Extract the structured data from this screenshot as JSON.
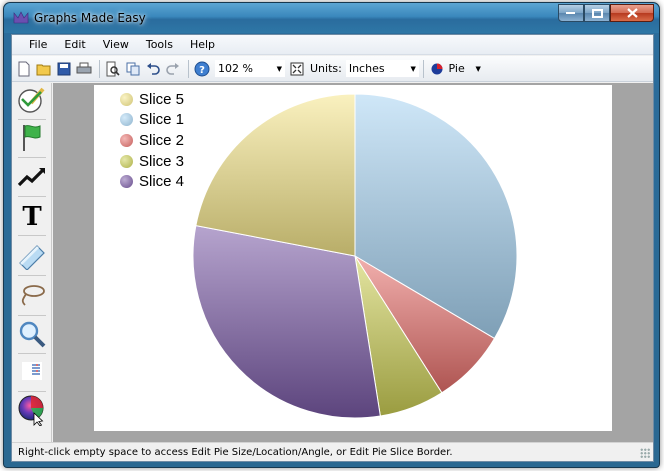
{
  "window": {
    "title": "Graphs Made Easy"
  },
  "menu": [
    "File",
    "Edit",
    "View",
    "Tools",
    "Help"
  ],
  "toolbar": {
    "zoom_value": "102 %",
    "units_label": "Units:",
    "units_value": "Inches",
    "chart_type_value": "Pie"
  },
  "palette": {
    "tools": [
      "select-tool",
      "flag-tool",
      "trend-line-tool",
      "text-tool",
      "eraser-tool",
      "lasso-tool",
      "zoom-tool",
      "table-tool",
      "pie-chart-tool"
    ]
  },
  "chart_data": {
    "type": "pie",
    "slices": [
      {
        "name": "Slice 1",
        "value": 33.5,
        "color": "#a8d4f2"
      },
      {
        "name": "Slice 2",
        "value": 7.5,
        "color": "#e8706c"
      },
      {
        "name": "Slice 3",
        "value": 6.5,
        "color": "#cdd055"
      },
      {
        "name": "Slice 4",
        "value": 30.5,
        "color": "#7a5aa6"
      },
      {
        "name": "Slice 5",
        "value": 22.0,
        "color": "#f5e68a"
      }
    ],
    "legend_order": [
      "Slice 5",
      "Slice 1",
      "Slice 2",
      "Slice 3",
      "Slice 4"
    ],
    "start_angle_deg": -90
  },
  "status": {
    "text": "Right-click empty space to access Edit Pie Size/Location/Angle, or Edit Pie Slice Border."
  }
}
